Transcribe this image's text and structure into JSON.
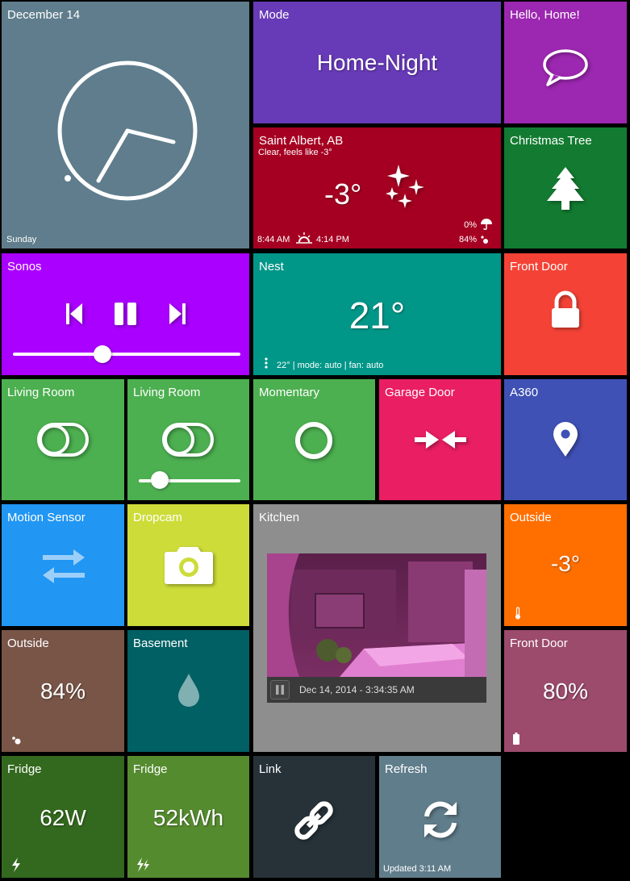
{
  "colors": {
    "clock": "#5f7d8c",
    "mode": "#673ab7",
    "hello": "#9c27b0",
    "weather": "#a50021",
    "tree": "#137b31",
    "sonos": "#aa00ff",
    "nest": "#009688",
    "frontdoor_lock": "#f44336",
    "living_room": "#4caf50",
    "momentary": "#4caf50",
    "garage": "#e91e63",
    "a360": "#3f51b5",
    "motion": "#2196f3",
    "dropcam": "#cddc39",
    "kitchen": "#8e8e8e",
    "outside_temp": "#ff6f00",
    "outside_hum": "#795548",
    "basement": "#006064",
    "frontdoor_batt": "#9c4b6d",
    "fridge_power": "#33691e",
    "fridge_energy": "#558b2f",
    "link": "#263238",
    "refresh": "#607d8b"
  },
  "clock": {
    "date": "December 14",
    "day": "Sunday",
    "icon": "clock-face"
  },
  "mode": {
    "title": "Mode",
    "value": "Home-Night"
  },
  "hello": {
    "title": "Hello, Home!",
    "icon": "speech-bubble-icon"
  },
  "weather": {
    "title": "Saint Albert, AB",
    "subtitle": "Clear, feels like -3°",
    "temp": "-3°",
    "sunrise": "8:44 AM",
    "sunset": "4:14 PM",
    "precip": "0%",
    "humidity": "84%",
    "icon": "clear-night-stars-icon"
  },
  "tree": {
    "title": "Christmas Tree",
    "icon": "tree-icon"
  },
  "sonos": {
    "title": "Sonos",
    "volume": 0.45,
    "icons": [
      "previous-icon",
      "pause-icon",
      "next-icon"
    ]
  },
  "nest": {
    "title": "Nest",
    "temp": "21°",
    "status": "22° | mode: auto | fan: auto"
  },
  "frontdoor_lock": {
    "title": "Front Door",
    "icon": "lock-icon"
  },
  "living1": {
    "title": "Living Room",
    "icon": "toggle-icon"
  },
  "living2": {
    "title": "Living Room",
    "icon": "toggle-icon",
    "level": 0.22
  },
  "momentary": {
    "title": "Momentary",
    "icon": "circle-icon"
  },
  "garage": {
    "title": "Garage Door",
    "icon": "compress-arrows-icon"
  },
  "a360": {
    "title": "A360",
    "icon": "map-pin-icon"
  },
  "motion": {
    "title": "Motion Sensor",
    "icon": "swap-arrows-icon"
  },
  "dropcam": {
    "title": "Dropcam",
    "icon": "camera-icon"
  },
  "kitchen": {
    "title": "Kitchen",
    "timestamp": "Dec 14, 2014 - 3:34:35 AM"
  },
  "outside_temp": {
    "title": "Outside",
    "value": "-3°",
    "icon": "thermometer-icon"
  },
  "outside_hum": {
    "title": "Outside",
    "value": "84%",
    "icon": "drops-icon"
  },
  "basement": {
    "title": "Basement",
    "icon": "water-drop-icon"
  },
  "frontdoor_batt": {
    "title": "Front Door",
    "value": "80%",
    "icon": "battery-icon"
  },
  "fridge_power": {
    "title": "Fridge",
    "value": "62W",
    "icon": "bolt-icon"
  },
  "fridge_energy": {
    "title": "Fridge",
    "value": "52kWh",
    "icon": "double-bolt-icon"
  },
  "link": {
    "title": "Link",
    "icon": "link-icon"
  },
  "refresh": {
    "title": "Refresh",
    "updated": "Updated 3:11 AM",
    "icon": "refresh-icon"
  }
}
